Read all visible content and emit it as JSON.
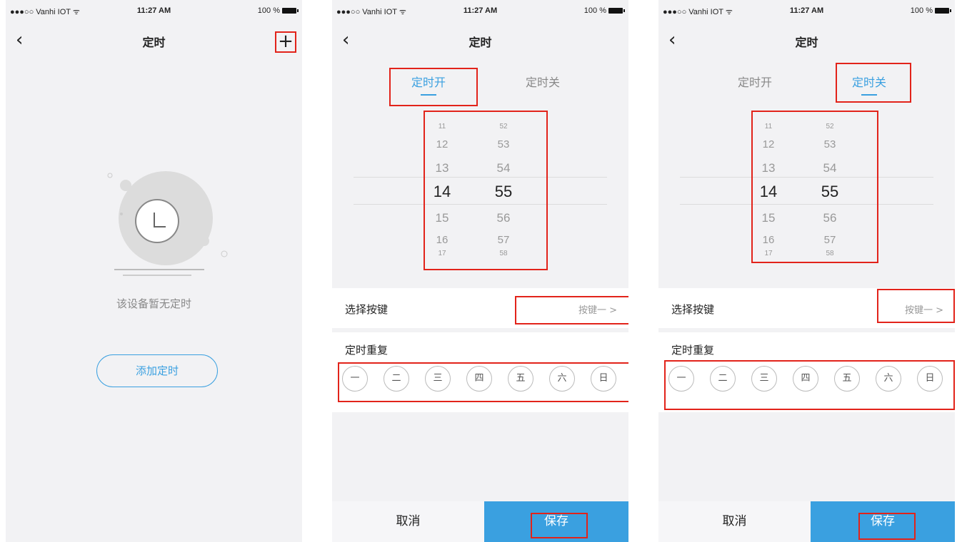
{
  "status_bar": {
    "carrier": "●●●○○ Vanhi IOT ᯤ",
    "time": "11:27 AM",
    "battery": "100 %"
  },
  "screens": [
    {
      "title": "定时",
      "empty_text": "该设备暂无定时",
      "add_button": "添加定时"
    },
    {
      "title": "定时",
      "tabs": [
        "定时开",
        "定时关"
      ],
      "active_tab": 0,
      "picker": {
        "hours": [
          "11",
          "12",
          "13",
          "14",
          "15",
          "16",
          "17"
        ],
        "minutes": [
          "52",
          "53",
          "54",
          "55",
          "56",
          "57",
          "58"
        ],
        "selected_hour": "14",
        "selected_minute": "55"
      },
      "select_key_label": "选择按键",
      "select_key_value": "按键一 >",
      "repeat_label": "定时重复",
      "days": [
        "一",
        "二",
        "三",
        "四",
        "五",
        "六",
        "日"
      ],
      "cancel": "取消",
      "save": "保存"
    },
    {
      "title": "定时",
      "tabs": [
        "定时开",
        "定时关"
      ],
      "active_tab": 1,
      "picker": {
        "hours": [
          "11",
          "12",
          "13",
          "14",
          "15",
          "16",
          "17"
        ],
        "minutes": [
          "52",
          "53",
          "54",
          "55",
          "56",
          "57",
          "58"
        ],
        "selected_hour": "14",
        "selected_minute": "55"
      },
      "select_key_label": "选择按键",
      "select_key_value": "按键一 >",
      "repeat_label": "定时重复",
      "days": [
        "一",
        "二",
        "三",
        "四",
        "五",
        "六",
        "日"
      ],
      "cancel": "取消",
      "save": "保存"
    }
  ],
  "colors": {
    "accent": "#3aa0e0",
    "highlight": "#e2231a",
    "background": "#f2f2f4"
  }
}
